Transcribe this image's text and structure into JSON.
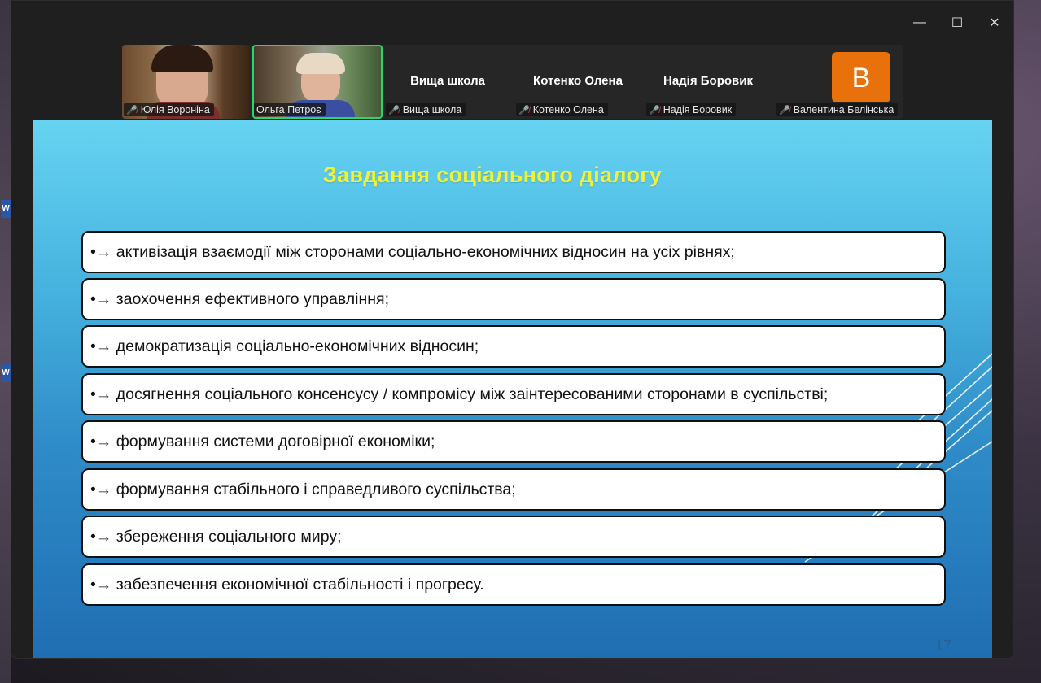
{
  "window": {
    "controls": {
      "minimize": "—",
      "maximize": "☐",
      "close": "✕"
    }
  },
  "participants": [
    {
      "name": "Юлія Вороніна",
      "type": "video",
      "muted": true
    },
    {
      "name": "Ольга Петроє",
      "type": "video",
      "muted": false,
      "active_speaker": true
    },
    {
      "name": "Вища школа",
      "display_name": "Вища школа",
      "type": "name",
      "muted": true
    },
    {
      "name": "Котенко Олена",
      "display_name": "Котенко Олена",
      "type": "name",
      "muted": true
    },
    {
      "name": "Надія Боровик",
      "display_name": "Надія Боровик",
      "type": "name",
      "muted": true
    },
    {
      "name": "Валентина Белінська",
      "initial": "В",
      "type": "avatar",
      "muted": true
    }
  ],
  "slide": {
    "title": "Завдання соціального діалогу",
    "items": [
      "•→ активізація взаємодії між сторонами соціально-економічних відносин на усіх рівнях;",
      "•→ заохочення ефективного управління;",
      "•→ демократизація соціально-економічних відносин;",
      "•→ досягнення соціального консенсусу / компромісу між заінтересованими сторонами в суспільстві;",
      "•→ формування системи договірної економіки;",
      "•→ формування стабільного і справедливого суспільства;",
      "•→ збереження соціального миру;",
      "•→ забезпечення економічної стабільності і прогресу."
    ],
    "page_number": "17"
  },
  "colors": {
    "title": "#f2f233",
    "active_speaker_border": "#2fd36b",
    "avatar_bg": "#e8710c",
    "muted_icon": "#e2454f"
  }
}
